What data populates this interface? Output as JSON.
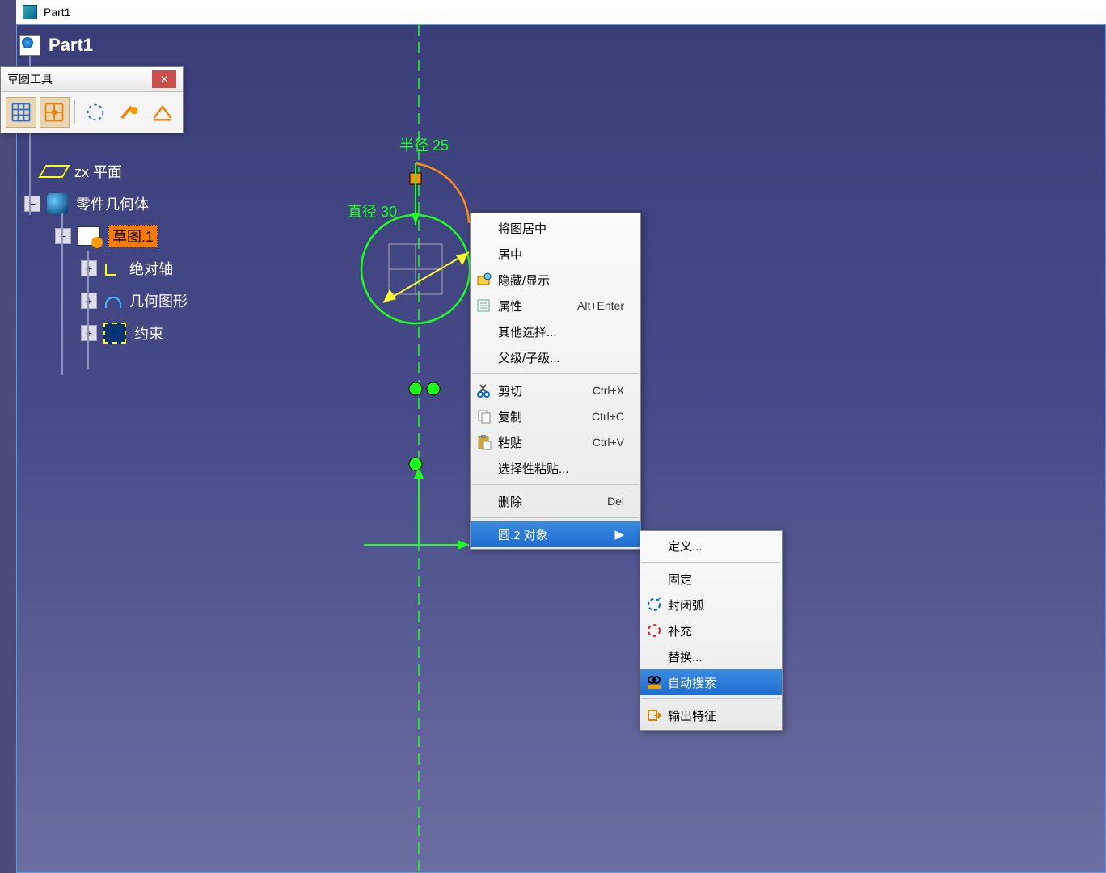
{
  "window": {
    "title": "Part1"
  },
  "tree": {
    "root": "Part1",
    "plane": "zx 平面",
    "body": "零件几何体",
    "sketch": "草图.1",
    "axis": "绝对轴",
    "geom": "几何图形",
    "constraints": "约束"
  },
  "toolbar": {
    "title": "草图工具",
    "close": "✕",
    "buttons": [
      "grid",
      "snap",
      "construction",
      "standard",
      "auto-constraint"
    ]
  },
  "dimensions": {
    "radius_label": "半径 25",
    "diameter_label": "直径 30"
  },
  "context_menu": {
    "center_graph": "将图居中",
    "center": "居中",
    "hide_show": "隐藏/显示",
    "properties": "属性",
    "properties_sc": "Alt+Enter",
    "other_select": "其他选择...",
    "parent_child": "父级/子级...",
    "cut": "剪切",
    "cut_sc": "Ctrl+X",
    "copy": "复制",
    "copy_sc": "Ctrl+C",
    "paste": "粘贴",
    "paste_sc": "Ctrl+V",
    "paste_special": "选择性粘贴...",
    "delete": "删除",
    "delete_sc": "Del",
    "object": "圆.2 对象"
  },
  "submenu": {
    "definition": "定义...",
    "fixed": "固定",
    "close_arc": "封闭弧",
    "fill": "补充",
    "replace": "替换...",
    "auto_search": "自动搜索",
    "output_feature": "输出特征"
  }
}
